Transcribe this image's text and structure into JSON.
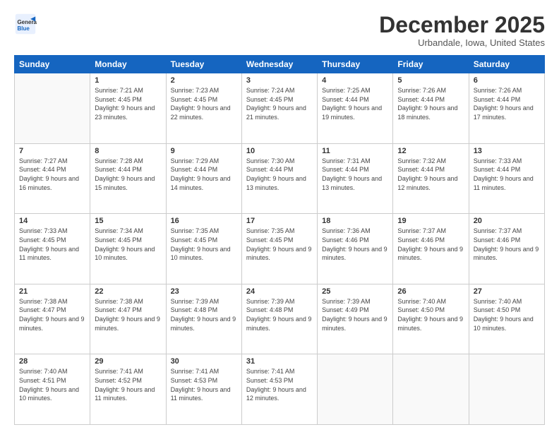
{
  "header": {
    "logo_line1": "General",
    "logo_line2": "Blue",
    "month_title": "December 2025",
    "location": "Urbandale, Iowa, United States"
  },
  "weekdays": [
    "Sunday",
    "Monday",
    "Tuesday",
    "Wednesday",
    "Thursday",
    "Friday",
    "Saturday"
  ],
  "rows": [
    [
      {
        "day": "",
        "sunrise": "",
        "sunset": "",
        "daylight": ""
      },
      {
        "day": "1",
        "sunrise": "Sunrise: 7:21 AM",
        "sunset": "Sunset: 4:45 PM",
        "daylight": "Daylight: 9 hours and 23 minutes."
      },
      {
        "day": "2",
        "sunrise": "Sunrise: 7:23 AM",
        "sunset": "Sunset: 4:45 PM",
        "daylight": "Daylight: 9 hours and 22 minutes."
      },
      {
        "day": "3",
        "sunrise": "Sunrise: 7:24 AM",
        "sunset": "Sunset: 4:45 PM",
        "daylight": "Daylight: 9 hours and 21 minutes."
      },
      {
        "day": "4",
        "sunrise": "Sunrise: 7:25 AM",
        "sunset": "Sunset: 4:44 PM",
        "daylight": "Daylight: 9 hours and 19 minutes."
      },
      {
        "day": "5",
        "sunrise": "Sunrise: 7:26 AM",
        "sunset": "Sunset: 4:44 PM",
        "daylight": "Daylight: 9 hours and 18 minutes."
      },
      {
        "day": "6",
        "sunrise": "Sunrise: 7:26 AM",
        "sunset": "Sunset: 4:44 PM",
        "daylight": "Daylight: 9 hours and 17 minutes."
      }
    ],
    [
      {
        "day": "7",
        "sunrise": "Sunrise: 7:27 AM",
        "sunset": "Sunset: 4:44 PM",
        "daylight": "Daylight: 9 hours and 16 minutes."
      },
      {
        "day": "8",
        "sunrise": "Sunrise: 7:28 AM",
        "sunset": "Sunset: 4:44 PM",
        "daylight": "Daylight: 9 hours and 15 minutes."
      },
      {
        "day": "9",
        "sunrise": "Sunrise: 7:29 AM",
        "sunset": "Sunset: 4:44 PM",
        "daylight": "Daylight: 9 hours and 14 minutes."
      },
      {
        "day": "10",
        "sunrise": "Sunrise: 7:30 AM",
        "sunset": "Sunset: 4:44 PM",
        "daylight": "Daylight: 9 hours and 13 minutes."
      },
      {
        "day": "11",
        "sunrise": "Sunrise: 7:31 AM",
        "sunset": "Sunset: 4:44 PM",
        "daylight": "Daylight: 9 hours and 13 minutes."
      },
      {
        "day": "12",
        "sunrise": "Sunrise: 7:32 AM",
        "sunset": "Sunset: 4:44 PM",
        "daylight": "Daylight: 9 hours and 12 minutes."
      },
      {
        "day": "13",
        "sunrise": "Sunrise: 7:33 AM",
        "sunset": "Sunset: 4:44 PM",
        "daylight": "Daylight: 9 hours and 11 minutes."
      }
    ],
    [
      {
        "day": "14",
        "sunrise": "Sunrise: 7:33 AM",
        "sunset": "Sunset: 4:45 PM",
        "daylight": "Daylight: 9 hours and 11 minutes."
      },
      {
        "day": "15",
        "sunrise": "Sunrise: 7:34 AM",
        "sunset": "Sunset: 4:45 PM",
        "daylight": "Daylight: 9 hours and 10 minutes."
      },
      {
        "day": "16",
        "sunrise": "Sunrise: 7:35 AM",
        "sunset": "Sunset: 4:45 PM",
        "daylight": "Daylight: 9 hours and 10 minutes."
      },
      {
        "day": "17",
        "sunrise": "Sunrise: 7:35 AM",
        "sunset": "Sunset: 4:45 PM",
        "daylight": "Daylight: 9 hours and 9 minutes."
      },
      {
        "day": "18",
        "sunrise": "Sunrise: 7:36 AM",
        "sunset": "Sunset: 4:46 PM",
        "daylight": "Daylight: 9 hours and 9 minutes."
      },
      {
        "day": "19",
        "sunrise": "Sunrise: 7:37 AM",
        "sunset": "Sunset: 4:46 PM",
        "daylight": "Daylight: 9 hours and 9 minutes."
      },
      {
        "day": "20",
        "sunrise": "Sunrise: 7:37 AM",
        "sunset": "Sunset: 4:46 PM",
        "daylight": "Daylight: 9 hours and 9 minutes."
      }
    ],
    [
      {
        "day": "21",
        "sunrise": "Sunrise: 7:38 AM",
        "sunset": "Sunset: 4:47 PM",
        "daylight": "Daylight: 9 hours and 9 minutes."
      },
      {
        "day": "22",
        "sunrise": "Sunrise: 7:38 AM",
        "sunset": "Sunset: 4:47 PM",
        "daylight": "Daylight: 9 hours and 9 minutes."
      },
      {
        "day": "23",
        "sunrise": "Sunrise: 7:39 AM",
        "sunset": "Sunset: 4:48 PM",
        "daylight": "Daylight: 9 hours and 9 minutes."
      },
      {
        "day": "24",
        "sunrise": "Sunrise: 7:39 AM",
        "sunset": "Sunset: 4:48 PM",
        "daylight": "Daylight: 9 hours and 9 minutes."
      },
      {
        "day": "25",
        "sunrise": "Sunrise: 7:39 AM",
        "sunset": "Sunset: 4:49 PM",
        "daylight": "Daylight: 9 hours and 9 minutes."
      },
      {
        "day": "26",
        "sunrise": "Sunrise: 7:40 AM",
        "sunset": "Sunset: 4:50 PM",
        "daylight": "Daylight: 9 hours and 9 minutes."
      },
      {
        "day": "27",
        "sunrise": "Sunrise: 7:40 AM",
        "sunset": "Sunset: 4:50 PM",
        "daylight": "Daylight: 9 hours and 10 minutes."
      }
    ],
    [
      {
        "day": "28",
        "sunrise": "Sunrise: 7:40 AM",
        "sunset": "Sunset: 4:51 PM",
        "daylight": "Daylight: 9 hours and 10 minutes."
      },
      {
        "day": "29",
        "sunrise": "Sunrise: 7:41 AM",
        "sunset": "Sunset: 4:52 PM",
        "daylight": "Daylight: 9 hours and 11 minutes."
      },
      {
        "day": "30",
        "sunrise": "Sunrise: 7:41 AM",
        "sunset": "Sunset: 4:53 PM",
        "daylight": "Daylight: 9 hours and 11 minutes."
      },
      {
        "day": "31",
        "sunrise": "Sunrise: 7:41 AM",
        "sunset": "Sunset: 4:53 PM",
        "daylight": "Daylight: 9 hours and 12 minutes."
      },
      {
        "day": "",
        "sunrise": "",
        "sunset": "",
        "daylight": ""
      },
      {
        "day": "",
        "sunrise": "",
        "sunset": "",
        "daylight": ""
      },
      {
        "day": "",
        "sunrise": "",
        "sunset": "",
        "daylight": ""
      }
    ]
  ]
}
